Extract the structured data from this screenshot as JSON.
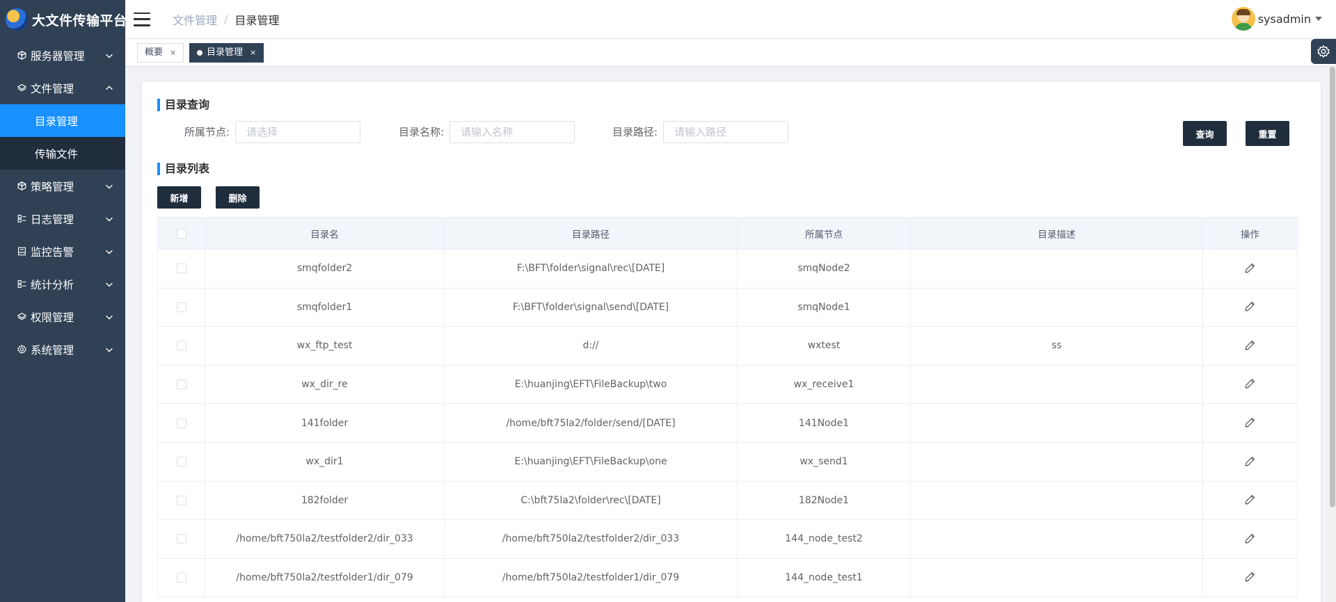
{
  "app": {
    "title": "大文件传输平台"
  },
  "sidebar": {
    "items": [
      {
        "label": "服务器管理",
        "icon": "cube-icon",
        "expanded": false
      },
      {
        "label": "文件管理",
        "icon": "layers-icon",
        "expanded": true,
        "children": [
          {
            "label": "目录管理",
            "active": true
          },
          {
            "label": "传输文件",
            "active": false
          }
        ]
      },
      {
        "label": "策略管理",
        "icon": "cube-icon",
        "expanded": false
      },
      {
        "label": "日志管理",
        "icon": "list-icon",
        "expanded": false
      },
      {
        "label": "监控告警",
        "icon": "monitor-icon",
        "expanded": false
      },
      {
        "label": "统计分析",
        "icon": "list-icon",
        "expanded": false
      },
      {
        "label": "权限管理",
        "icon": "layers-icon",
        "expanded": false
      },
      {
        "label": "系统管理",
        "icon": "gear-icon",
        "expanded": false
      }
    ]
  },
  "header": {
    "breadcrumb": {
      "parent": "文件管理",
      "separator": "/",
      "current": "目录管理"
    },
    "user": {
      "name": "sysadmin"
    }
  },
  "tags": [
    {
      "label": "概要",
      "active": false,
      "close": "×"
    },
    {
      "label": "目录管理",
      "active": true,
      "close": "×"
    }
  ],
  "query": {
    "title": "目录查询",
    "node_label": "所属节点:",
    "node_placeholder": "请选择",
    "name_label": "目录名称:",
    "name_placeholder": "请输入名称",
    "path_label": "目录路径:",
    "path_placeholder": "请输入路径",
    "search_label": "查询",
    "reset_label": "重置"
  },
  "list": {
    "title": "目录列表",
    "add_label": "新增",
    "delete_label": "删除",
    "columns": [
      "目录名",
      "目录路径",
      "所属节点",
      "目录描述",
      "操作"
    ],
    "rows": [
      {
        "name": "smqfolder2",
        "path": "F:\\BFT\\folder\\signal\\rec\\[DATE]",
        "node": "smqNode2",
        "desc": ""
      },
      {
        "name": "smqfolder1",
        "path": "F:\\BFT\\folder\\signal\\send\\[DATE]",
        "node": "smqNode1",
        "desc": ""
      },
      {
        "name": "wx_ftp_test",
        "path": "d://",
        "node": "wxtest",
        "desc": "ss"
      },
      {
        "name": "wx_dir_re",
        "path": "E:\\huanjing\\EFT\\FileBackup\\two",
        "node": "wx_receive1",
        "desc": ""
      },
      {
        "name": "141folder",
        "path": "/home/bft75la2/folder/send/[DATE]",
        "node": "141Node1",
        "desc": ""
      },
      {
        "name": "wx_dir1",
        "path": "E:\\huanjing\\EFT\\FileBackup\\one",
        "node": "wx_send1",
        "desc": ""
      },
      {
        "name": "182folder",
        "path": "C:\\bft75la2\\folder\\rec\\[DATE]",
        "node": "182Node1",
        "desc": ""
      },
      {
        "name": "/home/bft750la2/testfolder2/dir_033",
        "path": "/home/bft750la2/testfolder2/dir_033",
        "node": "144_node_test2",
        "desc": ""
      },
      {
        "name": "/home/bft750la2/testfolder1/dir_079",
        "path": "/home/bft750la2/testfolder1/dir_079",
        "node": "144_node_test1",
        "desc": ""
      }
    ]
  }
}
